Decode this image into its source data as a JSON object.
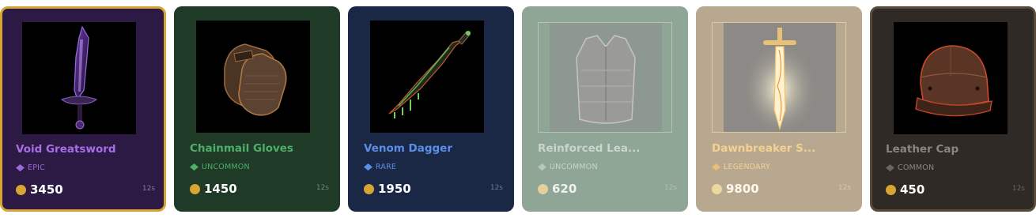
{
  "items": [
    {
      "name": "Void Greatsword",
      "rarity": "EPIC",
      "price": "3450",
      "timer": "12s",
      "bg": "#2c1a45",
      "name_color": "#a86ee6",
      "rarity_color": "#9a6ad8",
      "art_icon": "greatsword-icon",
      "selected": true,
      "dim": false
    },
    {
      "name": "Chainmail Gloves",
      "rarity": "UNCOMMON",
      "price": "1450",
      "timer": "12s",
      "bg": "#1f3a26",
      "name_color": "#4fae6a",
      "rarity_color": "#4fae6a",
      "art_icon": "gloves-icon",
      "selected": false,
      "dim": false
    },
    {
      "name": "Venom Dagger",
      "rarity": "RARE",
      "price": "1950",
      "timer": "12s",
      "bg": "#1a2846",
      "name_color": "#5a8ee8",
      "rarity_color": "#5a8ee8",
      "art_icon": "dagger-icon",
      "selected": false,
      "dim": false
    },
    {
      "name": "Reinforced Lea...",
      "rarity": "UNCOMMON",
      "price": "620",
      "timer": "12s",
      "bg": "#8fa596",
      "name_color": "#c9d6cc",
      "rarity_color": "#c9d6cc",
      "art_icon": "vest-icon",
      "selected": false,
      "dim": true
    },
    {
      "name": "Dawnbreaker S...",
      "rarity": "LEGENDARY",
      "price": "9800",
      "timer": "12s",
      "bg": "#b8a890",
      "name_color": "#f3d291",
      "rarity_color": "#f3d291",
      "art_icon": "holy-sword-icon",
      "selected": false,
      "dim": true
    },
    {
      "name": "Leather Cap",
      "rarity": "COMMON",
      "price": "450",
      "timer": "12s",
      "bg": "#2f2a26",
      "name_color": "#8a8580",
      "rarity_color": "#8a8580",
      "art_icon": "cap-icon",
      "selected": false,
      "dim": false
    }
  ],
  "colors": {
    "coin": "#d6a533",
    "selected_border": "#d6a533",
    "text_white": "#ffffff",
    "timer": "#8a8a8a"
  }
}
